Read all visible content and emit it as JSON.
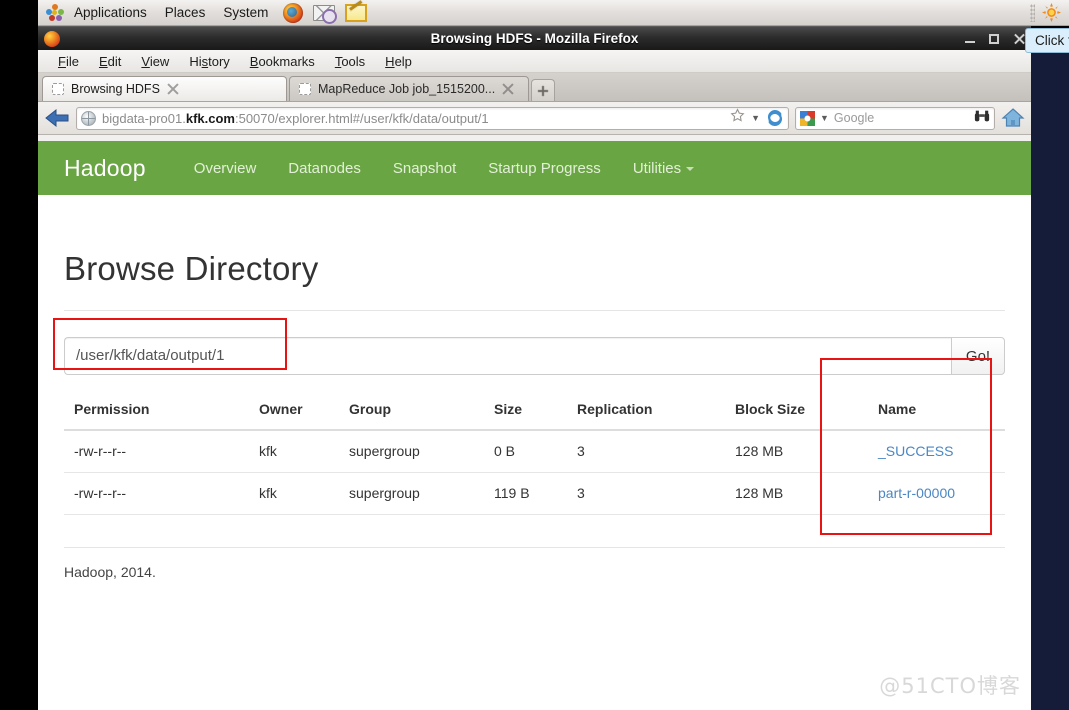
{
  "desktop": {
    "panel": {
      "menus": [
        "Applications",
        "Places",
        "System"
      ],
      "launchers": [
        "firefox-icon",
        "mail-icon",
        "text-editor-icon"
      ],
      "tray": [
        "brightness-sun-icon"
      ]
    }
  },
  "window": {
    "title": "Browsing HDFS - Mozilla Firefox",
    "controls": {
      "minimize": "minimize-icon",
      "maximize": "maximize-icon",
      "close": "close-icon"
    }
  },
  "menubar": {
    "items": [
      {
        "label": "File",
        "accel": "F"
      },
      {
        "label": "Edit",
        "accel": "E"
      },
      {
        "label": "View",
        "accel": "V"
      },
      {
        "label": "History",
        "accel": "s"
      },
      {
        "label": "Bookmarks",
        "accel": "B"
      },
      {
        "label": "Tools",
        "accel": "T"
      },
      {
        "label": "Help",
        "accel": "H"
      }
    ]
  },
  "tabs": {
    "items": [
      {
        "label": "Browsing HDFS",
        "active": true
      },
      {
        "label": "MapReduce Job job_1515200...",
        "active": false
      }
    ],
    "new_tab_label": "+"
  },
  "navbar": {
    "back_label": "Back",
    "url_prefix": "bigdata-pro01.",
    "url_domain": "kfk.com",
    "url_suffix": ":50070/explorer.html#/user/kfk/data/output/1",
    "url_full": "bigdata-pro01.kfk.com:50070/explorer.html#/user/kfk/data/output/1",
    "search_placeholder": "Google",
    "search_engine": "Google",
    "home_label": "Home"
  },
  "tooltip": {
    "text": "Click t"
  },
  "hadoop": {
    "brand": "Hadoop",
    "nav": [
      {
        "label": "Overview",
        "has_caret": false
      },
      {
        "label": "Datanodes",
        "has_caret": false
      },
      {
        "label": "Snapshot",
        "has_caret": false
      },
      {
        "label": "Startup Progress",
        "has_caret": false
      },
      {
        "label": "Utilities",
        "has_caret": true
      }
    ],
    "nav_bg": "#6aa544"
  },
  "main": {
    "title": "Browse Directory",
    "path_value": "/user/kfk/data/output/1",
    "go_label": "Go!",
    "table": {
      "headers": [
        "Permission",
        "Owner",
        "Group",
        "Size",
        "Replication",
        "Block Size",
        "Name"
      ],
      "rows": [
        {
          "permission": "-rw-r--r--",
          "owner": "kfk",
          "group": "supergroup",
          "size": "0 B",
          "replication": "3",
          "block_size": "128 MB",
          "name": "_SUCCESS"
        },
        {
          "permission": "-rw-r--r--",
          "owner": "kfk",
          "group": "supergroup",
          "size": "119 B",
          "replication": "3",
          "block_size": "128 MB",
          "name": "part-r-00000"
        }
      ]
    },
    "footer": "Hadoop, 2014."
  },
  "annotations": {
    "color": "#e81313",
    "boxes": [
      "path-input-highlight",
      "name-column-highlight"
    ]
  },
  "watermark": "@51CTO博客"
}
